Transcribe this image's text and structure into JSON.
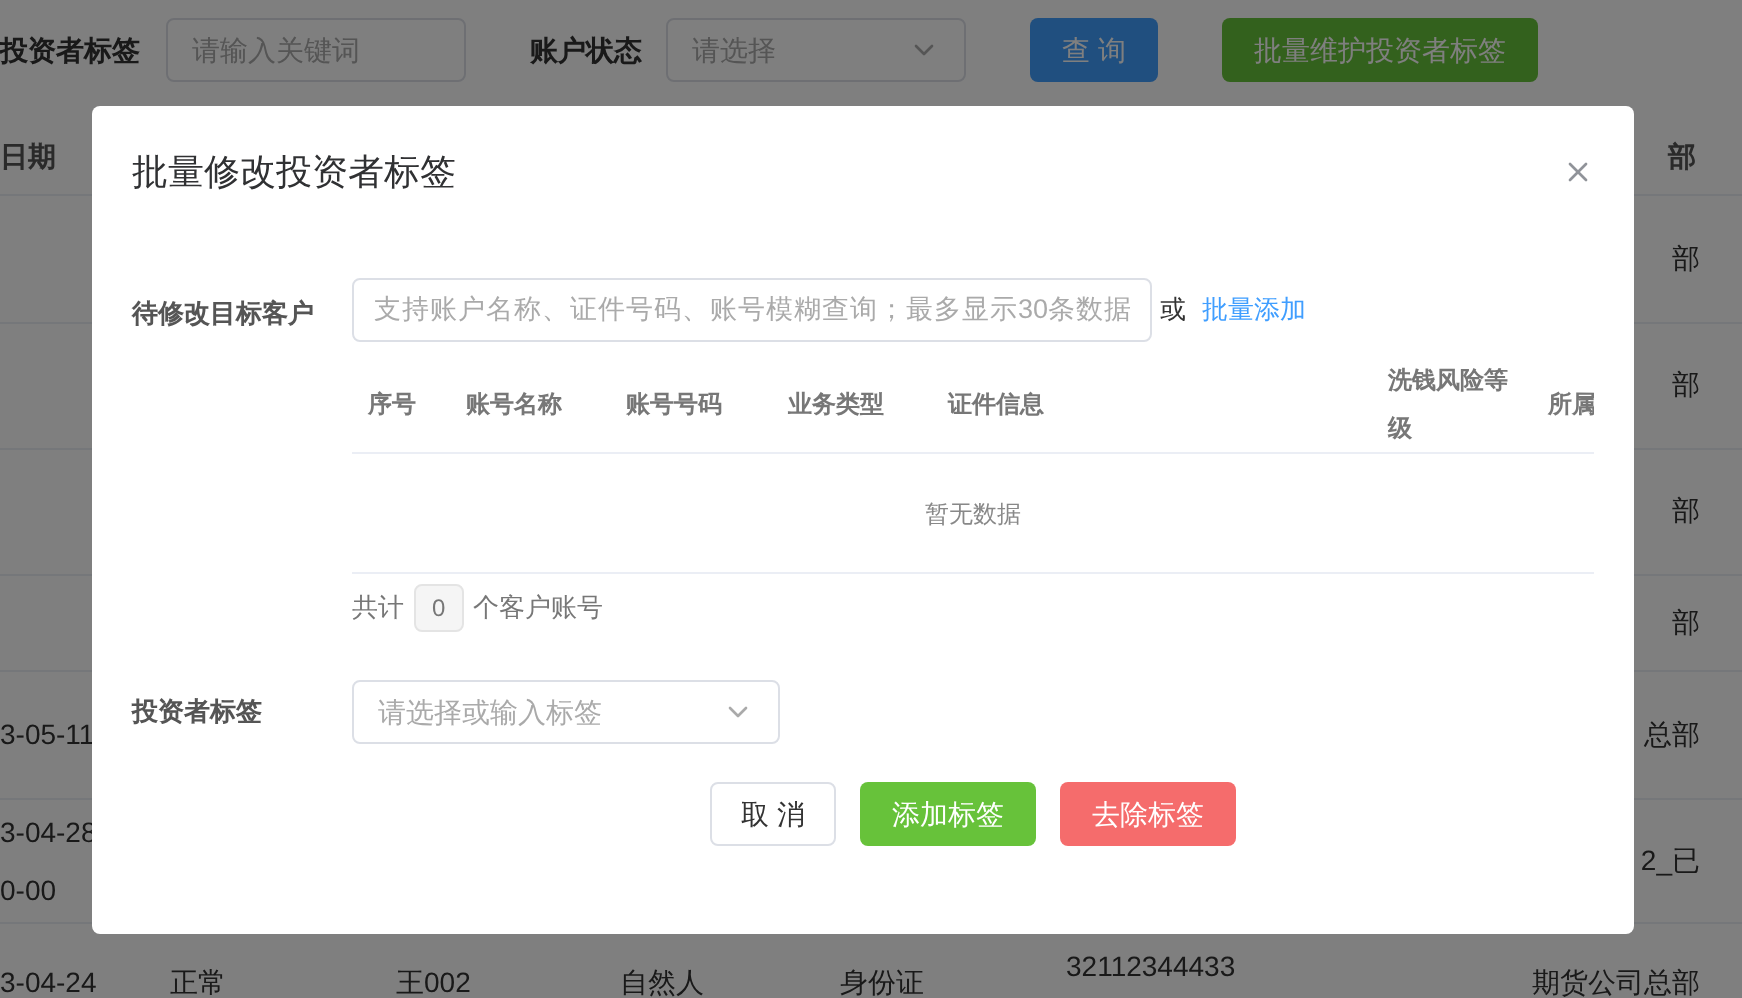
{
  "page": {
    "filters": [
      {
        "label": "投资者标签",
        "placeholder": "请输入关键词",
        "kind": "input"
      },
      {
        "label": "账户状态",
        "placeholder": "请选择",
        "kind": "select"
      }
    ],
    "buttons": [
      {
        "label": "查 询",
        "kind": "primary"
      },
      {
        "label": "批量维护投资者标签",
        "kind": "success"
      }
    ],
    "table": {
      "columns": [
        "日期",
        "部"
      ],
      "rows": [
        {
          "dept": "部"
        },
        {
          "dept": "部"
        },
        {
          "dept": "部"
        },
        {
          "dept": "部"
        },
        {
          "date": [
            "3-05-11"
          ],
          "dept": "总部"
        },
        {
          "date": [
            "3-04-28",
            "0-00"
          ],
          "dept": "2_已"
        },
        {
          "date": [
            "3-04-24"
          ],
          "status": "正常",
          "name": "王002",
          "type": "自然人",
          "id_type": "身份证",
          "id_no": "32112344433",
          "dept": "期货公司总部"
        }
      ]
    }
  },
  "dialog": {
    "title": "批量修改投资者标签",
    "target_field": {
      "label": "待修改目标客户",
      "placeholder": "支持账户名称、证件号码、账号模糊查询；最多显示30条数据",
      "or_text": "或",
      "link": "批量添加"
    },
    "table": {
      "columns": [
        "序号",
        "账号名称",
        "账号号码",
        "业务类型",
        "证件信息",
        "洗钱风险等级",
        "所属"
      ],
      "empty_text": "暂无数据"
    },
    "count": {
      "prefix": "共计",
      "value": "0",
      "suffix": "个客户账号"
    },
    "tag_field": {
      "label": "投资者标签",
      "placeholder": "请选择或输入标签"
    },
    "buttons": [
      {
        "label": "取 消",
        "kind": "default"
      },
      {
        "label": "添加标签",
        "kind": "success"
      },
      {
        "label": "去除标签",
        "kind": "danger"
      }
    ]
  }
}
